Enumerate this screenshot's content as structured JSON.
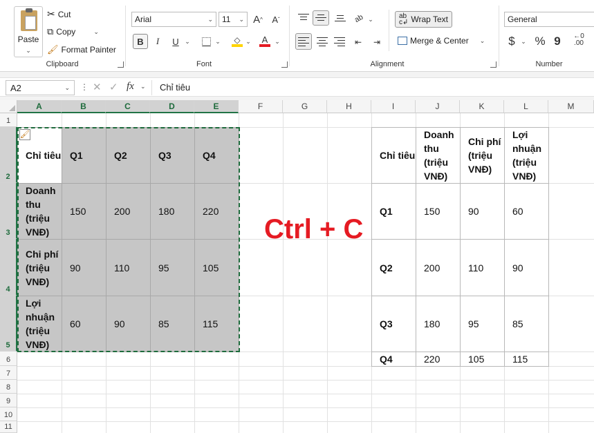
{
  "clipboard": {
    "paste_label": "Paste",
    "cut_label": "Cut",
    "copy_label": "Copy",
    "format_painter_label": "Format Painter",
    "group_label": "Clipboard"
  },
  "font": {
    "family": "Arial",
    "size": "11",
    "grow_icon": "A^",
    "shrink_icon": "Aˇ",
    "bold": "B",
    "italic": "I",
    "underline": "U",
    "font_color_glyph": "A",
    "group_label": "Font",
    "fill_color": "#ffd400",
    "text_color": "#e51b23"
  },
  "alignment": {
    "wrap_text_label": "Wrap Text",
    "merge_label": "Merge & Center",
    "group_label": "Alignment",
    "orientation_glyph": "ab"
  },
  "number": {
    "format": "General",
    "currency_glyph": "$",
    "percent_glyph": "%",
    "comma_glyph": "9",
    "decimal_glyph": ".00",
    "group_label": "Number"
  },
  "formula_bar": {
    "name_box": "A2",
    "fx": "fx",
    "content": "Chỉ tiêu"
  },
  "columns": [
    "A",
    "B",
    "C",
    "D",
    "E",
    "F",
    "G",
    "H",
    "I",
    "J",
    "K",
    "L",
    "M"
  ],
  "rows": [
    "1",
    "2",
    "3",
    "4",
    "5",
    "6",
    "7",
    "8",
    "9",
    "10",
    "11"
  ],
  "left_table": {
    "header": [
      "Chỉ tiêu",
      "Q1",
      "Q2",
      "Q3",
      "Q4"
    ],
    "rows": [
      [
        "Doanh thu (triệu VNĐ)",
        "150",
        "200",
        "180",
        "220"
      ],
      [
        "Chi phí (triệu VNĐ)",
        "90",
        "110",
        "95",
        "105"
      ],
      [
        "Lợi nhuận (triệu VNĐ)",
        "60",
        "90",
        "85",
        "115"
      ]
    ]
  },
  "right_table": {
    "header": [
      "Chỉ tiêu",
      "Doanh thu (triệu VNĐ)",
      "Chi phí (triệu VNĐ)",
      "Lợi nhuận (triệu VNĐ)"
    ],
    "rows": [
      [
        "Q1",
        "150",
        "90",
        "60"
      ],
      [
        "Q2",
        "200",
        "110",
        "90"
      ],
      [
        "Q3",
        "180",
        "95",
        "85"
      ],
      [
        "Q4",
        "220",
        "105",
        "115"
      ]
    ]
  },
  "overlay_text": "Ctrl + C",
  "overlay_color": "#e51b23",
  "accent_color": "#217346"
}
